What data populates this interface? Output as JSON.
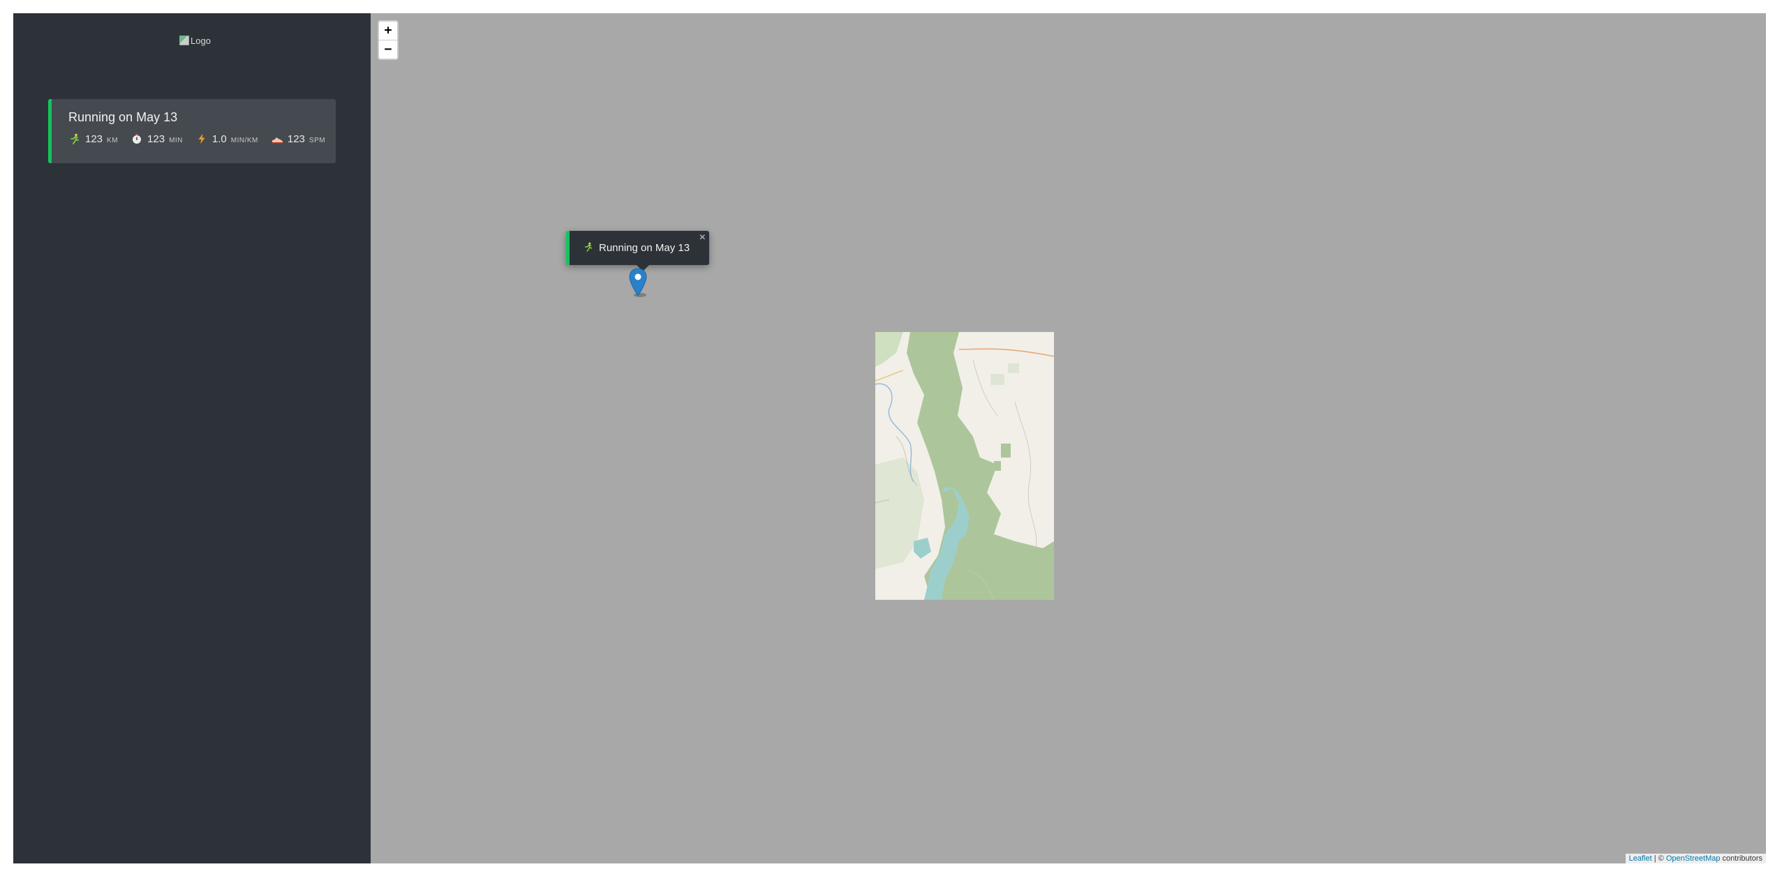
{
  "sidebar": {
    "logo_alt": "Logo",
    "workouts": [
      {
        "title": "Running on May 13",
        "icon": "running-icon",
        "stats": {
          "distance": {
            "icon": "running-icon",
            "value": "123",
            "unit": "KM"
          },
          "duration": {
            "icon": "stopwatch-icon",
            "value": "123",
            "unit": "MIN"
          },
          "pace": {
            "icon": "lightning-icon",
            "value": "1.0",
            "unit": "MIN/KM"
          },
          "cadence": {
            "icon": "shoe-icon",
            "value": "123",
            "unit": "SPM"
          }
        }
      }
    ]
  },
  "map": {
    "zoom_in": "+",
    "zoom_out": "−",
    "popup": {
      "icon": "running-icon",
      "text": "Running on May 13",
      "close": "×"
    },
    "attribution": {
      "leaflet": "Leaflet",
      "separator": " | © ",
      "osm": "OpenStreetMap",
      "suffix": " contributors"
    }
  },
  "colors": {
    "sidebar_bg": "#2c3238",
    "card_bg": "#454a50",
    "accent_green": "#16c35f",
    "map_bg": "#a8a8a8",
    "marker_blue": "#2a81cb"
  }
}
